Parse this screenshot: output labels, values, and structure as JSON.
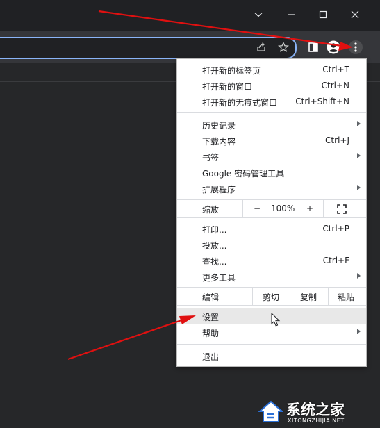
{
  "window": {
    "controls": [
      "chevron-down",
      "minimize",
      "maximize",
      "close"
    ]
  },
  "toolbar": {
    "icons": [
      "share-icon",
      "star-icon",
      "side-panel-icon",
      "profile-icon",
      "menu-icon"
    ]
  },
  "menu": {
    "group1": [
      {
        "label": "打开新的标签页",
        "shortcut": "Ctrl+T"
      },
      {
        "label": "打开新的窗口",
        "shortcut": "Ctrl+N"
      },
      {
        "label": "打开新的无痕式窗口",
        "shortcut": "Ctrl+Shift+N"
      }
    ],
    "group2": [
      {
        "label": "历史记录",
        "submenu": true
      },
      {
        "label": "下载内容",
        "shortcut": "Ctrl+J"
      },
      {
        "label": "书签",
        "submenu": true
      },
      {
        "label": "Google 密码管理工具"
      },
      {
        "label": "扩展程序",
        "submenu": true
      }
    ],
    "zoom": {
      "label": "缩放",
      "minus": "−",
      "value": "100%",
      "plus": "+"
    },
    "group3": [
      {
        "label": "打印...",
        "shortcut": "Ctrl+P"
      },
      {
        "label": "投放..."
      },
      {
        "label": "查找...",
        "shortcut": "Ctrl+F"
      },
      {
        "label": "更多工具",
        "submenu": true
      }
    ],
    "edit": {
      "label": "编辑",
      "cut": "剪切",
      "copy": "复制",
      "paste": "粘贴"
    },
    "settings": "设置",
    "help": "帮助",
    "exit": "退出"
  },
  "watermark": {
    "title": "系统之家",
    "subtitle": "XITONGZHIJIA.NET"
  },
  "colors": {
    "arrow": "#e01010",
    "accent": "#8ab4f8",
    "menu_bg": "#ffffff",
    "highlight": "#e8e8e8"
  }
}
